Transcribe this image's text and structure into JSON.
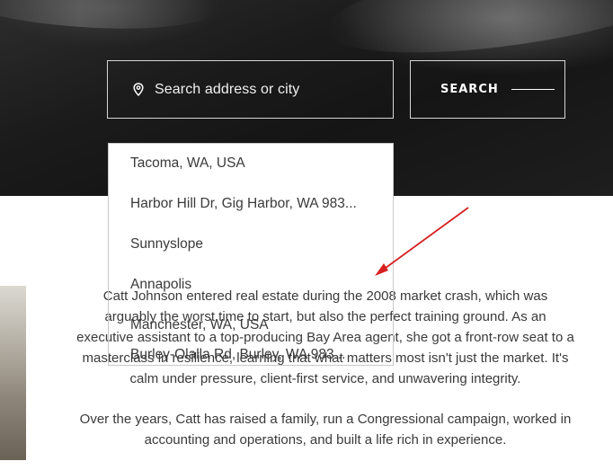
{
  "search": {
    "placeholder": "Search address or city",
    "button_label": "SEARCH",
    "icon": "location-pin-icon"
  },
  "suggestions": [
    "Tacoma, WA, USA",
    "Harbor Hill Dr, Gig Harbor, WA 983...",
    "Sunnyslope",
    "Annapolis",
    "Manchester, WA, USA",
    "Burley-Olalla Rd, Burley, WA 983..."
  ],
  "bio": {
    "paragraph1": "Catt Johnson entered real estate during the 2008 market crash, which was arguably the worst time to start, but also the perfect training ground. As an executive assistant to a top-producing Bay Area agent, she got a front-row seat to a masterclass in resilience, learning that what matters most isn't just the market. It's calm under pressure, client-first service, and unwavering integrity.",
    "paragraph2": "Over the years, Catt has raised a family, run a Congressional campaign, worked in accounting and operations, and built a life rich in experience."
  },
  "colors": {
    "hero_bg": "#1b1b1b",
    "annotation_arrow": "#d62020",
    "body_text": "#3a3a3a"
  }
}
